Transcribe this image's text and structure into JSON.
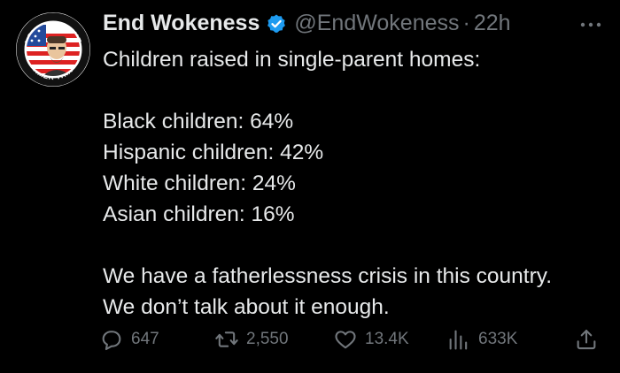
{
  "tweet": {
    "display_name": "End Wokeness",
    "handle": "@EndWokeness",
    "separator": "·",
    "time": "22h",
    "avatar_text_top": "I SUPPORT THE",
    "avatar_text_bottom": "FORMER THINGS",
    "lines": {
      "intro": "Children raised in single-parent homes:",
      "black": "Black children: 64%",
      "hispanic": "Hispanic children: 42%",
      "white": "White children: 24%",
      "asian": "Asian children: 16%",
      "closing1": "We have a fatherlessness crisis in this country.",
      "closing2": "We don’t talk about it enough."
    }
  },
  "actions": {
    "replies": "647",
    "reposts": "2,550",
    "likes": "13.4K",
    "views": "633K"
  },
  "colors": {
    "background": "#000000",
    "text": "#e7e9ea",
    "muted": "#71767b",
    "verified": "#1d9bf0"
  },
  "icons": [
    "verified-badge-icon",
    "more-options-icon",
    "reply-icon",
    "repost-icon",
    "like-icon",
    "views-icon",
    "share-icon"
  ]
}
